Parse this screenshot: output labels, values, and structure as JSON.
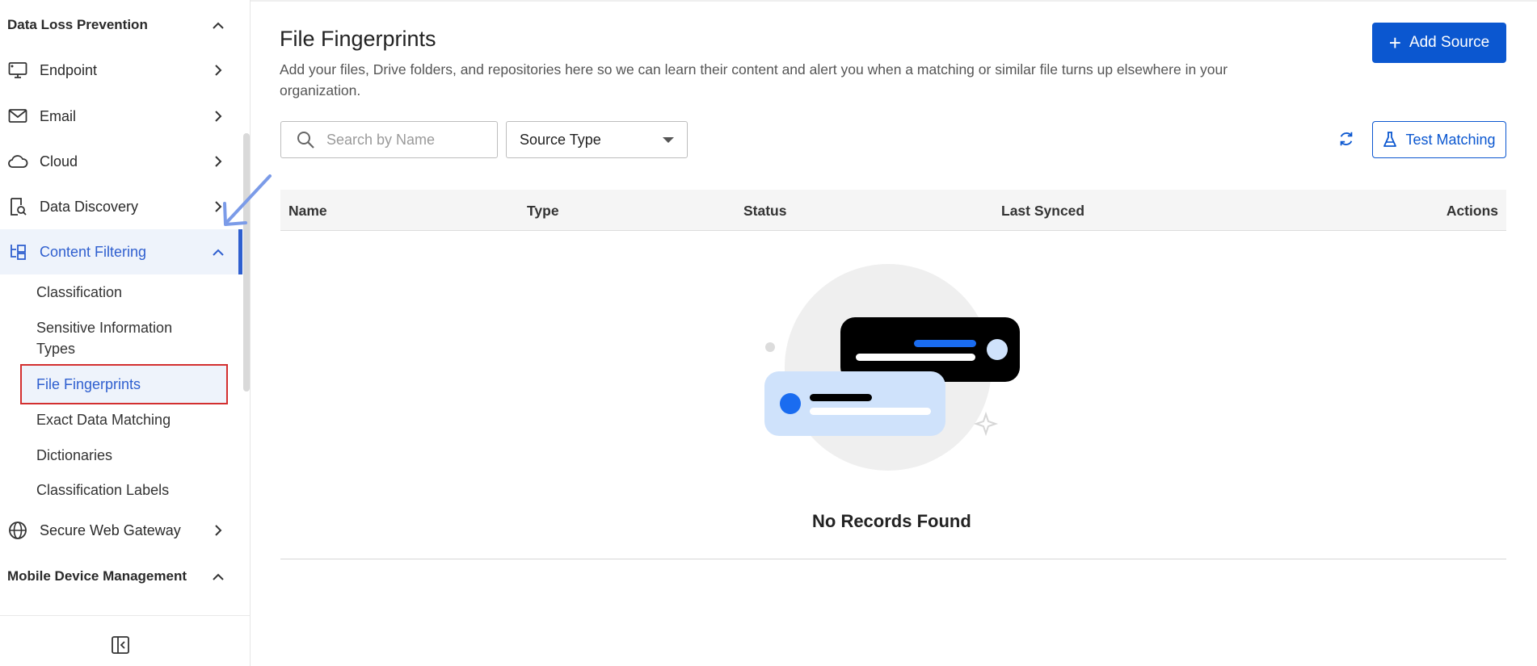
{
  "sidebar": {
    "section_dlp": "Data Loss Prevention",
    "items": [
      {
        "label": "Endpoint",
        "icon": "monitor-icon"
      },
      {
        "label": "Email",
        "icon": "mail-icon"
      },
      {
        "label": "Cloud",
        "icon": "cloud-icon"
      },
      {
        "label": "Data Discovery",
        "icon": "document-search-icon"
      },
      {
        "label": "Content Filtering",
        "icon": "tree-icon"
      }
    ],
    "subitems": [
      {
        "label": "Classification"
      },
      {
        "label": "Sensitive Information Types"
      },
      {
        "label": "File Fingerprints"
      },
      {
        "label": "Exact Data Matching"
      },
      {
        "label": "Dictionaries"
      },
      {
        "label": "Classification Labels"
      }
    ],
    "item_swg": "Secure Web Gateway",
    "section_mdm": "Mobile Device Management",
    "active_item": "Content Filtering",
    "selected_subitem": "File Fingerprints"
  },
  "main": {
    "title": "File Fingerprints",
    "description": "Add your files, Drive folders, and repositories here so we can learn their content and alert you when a matching or similar file turns up elsewhere in your organization.",
    "add_button": "Add Source",
    "search_placeholder": "Search by Name",
    "source_type_label": "Source Type",
    "test_button": "Test Matching",
    "table": {
      "columns": [
        "Name",
        "Type",
        "Status",
        "Last Synced",
        "Actions"
      ]
    },
    "empty_state": "No Records Found"
  },
  "colors": {
    "accent": "#0b57d0",
    "active_nav": "#2f5fcf",
    "selection_border": "#d32f2f"
  }
}
